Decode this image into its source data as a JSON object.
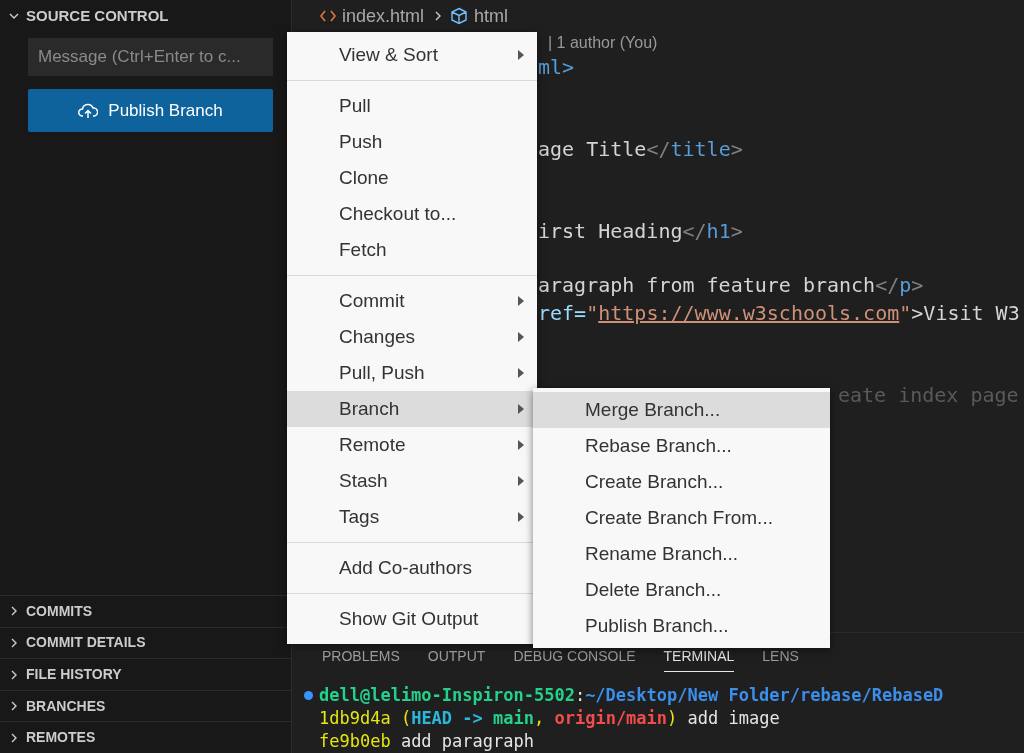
{
  "sidebar": {
    "title": "SOURCE CONTROL",
    "expanded": true,
    "message_placeholder": "Message (Ctrl+Enter to c...",
    "publish_button": "Publish Branch",
    "sections": [
      {
        "label": "COMMITS",
        "expanded": false
      },
      {
        "label": "COMMIT DETAILS",
        "expanded": false
      },
      {
        "label": "FILE HISTORY",
        "expanded": false
      },
      {
        "label": "BRANCHES",
        "expanded": false
      },
      {
        "label": "REMOTES",
        "expanded": false
      }
    ]
  },
  "editor": {
    "breadcrumbs": [
      {
        "label": "index.html",
        "kind": "file"
      },
      {
        "label": "html",
        "kind": "element"
      }
    ],
    "blame": "| 1 author (You)",
    "lines": [
      {
        "kind": "code",
        "segments": [
          {
            "text": "ml>",
            "kind": "tag"
          }
        ]
      },
      {
        "kind": "blank"
      },
      {
        "kind": "blank"
      },
      {
        "kind": "code",
        "segments": [
          {
            "text": "age Title",
            "kind": "text"
          },
          {
            "text": "</",
            "kind": "punct"
          },
          {
            "text": "title",
            "kind": "tag"
          },
          {
            "text": ">",
            "kind": "punct"
          }
        ]
      },
      {
        "kind": "blank"
      },
      {
        "kind": "blank"
      },
      {
        "kind": "code",
        "segments": [
          {
            "text": "irst Heading",
            "kind": "text"
          },
          {
            "text": "</",
            "kind": "punct"
          },
          {
            "text": "h1",
            "kind": "tag"
          },
          {
            "text": ">",
            "kind": "punct"
          }
        ]
      },
      {
        "kind": "blank"
      },
      {
        "kind": "code",
        "segments": [
          {
            "text": "aragraph from feature branch",
            "kind": "text"
          },
          {
            "text": "</",
            "kind": "punct"
          },
          {
            "text": "p",
            "kind": "tag"
          },
          {
            "text": ">",
            "kind": "punct"
          }
        ]
      },
      {
        "kind": "code",
        "segments": [
          {
            "text": "ref=",
            "kind": "attr"
          },
          {
            "text": "\"",
            "kind": "string"
          },
          {
            "text": "https://www.w3schools.com",
            "kind": "link"
          },
          {
            "text": "\"",
            "kind": "string"
          },
          {
            "text": ">Visit W3",
            "kind": "text"
          }
        ]
      },
      {
        "kind": "blank"
      },
      {
        "kind": "blank"
      },
      {
        "kind": "ghost",
        "segments": [
          {
            "text": "eate index page",
            "kind": "ghost"
          }
        ]
      }
    ]
  },
  "panel": {
    "tabs": [
      {
        "label": "PROBLEMS",
        "selected": false
      },
      {
        "label": "OUTPUT",
        "selected": false
      },
      {
        "label": "DEBUG CONSOLE",
        "selected": false
      },
      {
        "label": "TERMINAL",
        "selected": true
      },
      {
        "label": "LENS",
        "selected": false
      }
    ],
    "terminal": [
      [
        {
          "text": "dell@lelimo-Inspiron-5502",
          "kind": "green"
        },
        {
          "text": ":",
          "kind": "white"
        },
        {
          "text": "~/Desktop/New Folder/rebase/RebaseD",
          "kind": "blue"
        }
      ],
      [
        {
          "text": "1db9d4a",
          "kind": "yellow"
        },
        {
          "text": " (",
          "kind": "yellow"
        },
        {
          "text": "HEAD -> ",
          "kind": "cyan"
        },
        {
          "text": "main",
          "kind": "green"
        },
        {
          "text": ", ",
          "kind": "yellow"
        },
        {
          "text": "origin/main",
          "kind": "red"
        },
        {
          "text": ")",
          "kind": "yellow"
        },
        {
          "text": " add image",
          "kind": "white"
        }
      ],
      [
        {
          "text": "fe9b0eb",
          "kind": "yellow"
        },
        {
          "text": " add paragraph",
          "kind": "white"
        }
      ]
    ]
  },
  "menu": {
    "groups": [
      [
        {
          "label": "View & Sort",
          "submenu": true,
          "selected": false
        }
      ],
      [
        {
          "label": "Pull",
          "submenu": false,
          "selected": false
        },
        {
          "label": "Push",
          "submenu": false,
          "selected": false
        },
        {
          "label": "Clone",
          "submenu": false,
          "selected": false
        },
        {
          "label": "Checkout to...",
          "submenu": false,
          "selected": false
        },
        {
          "label": "Fetch",
          "submenu": false,
          "selected": false
        }
      ],
      [
        {
          "label": "Commit",
          "submenu": true,
          "selected": false
        },
        {
          "label": "Changes",
          "submenu": true,
          "selected": false
        },
        {
          "label": "Pull, Push",
          "submenu": true,
          "selected": false
        },
        {
          "label": "Branch",
          "submenu": true,
          "selected": true
        },
        {
          "label": "Remote",
          "submenu": true,
          "selected": false
        },
        {
          "label": "Stash",
          "submenu": true,
          "selected": false
        },
        {
          "label": "Tags",
          "submenu": true,
          "selected": false
        }
      ],
      [
        {
          "label": "Add Co-authors",
          "submenu": false,
          "selected": false
        }
      ],
      [
        {
          "label": "Show Git Output",
          "submenu": false,
          "selected": false
        }
      ]
    ],
    "submenu": [
      {
        "label": "Merge Branch...",
        "selected": true
      },
      {
        "label": "Rebase Branch...",
        "selected": false
      },
      {
        "label": "Create Branch...",
        "selected": false
      },
      {
        "label": "Create Branch From...",
        "selected": false
      },
      {
        "label": "Rename Branch...",
        "selected": false
      },
      {
        "label": "Delete Branch...",
        "selected": false
      },
      {
        "label": "Publish Branch...",
        "selected": false
      }
    ]
  }
}
